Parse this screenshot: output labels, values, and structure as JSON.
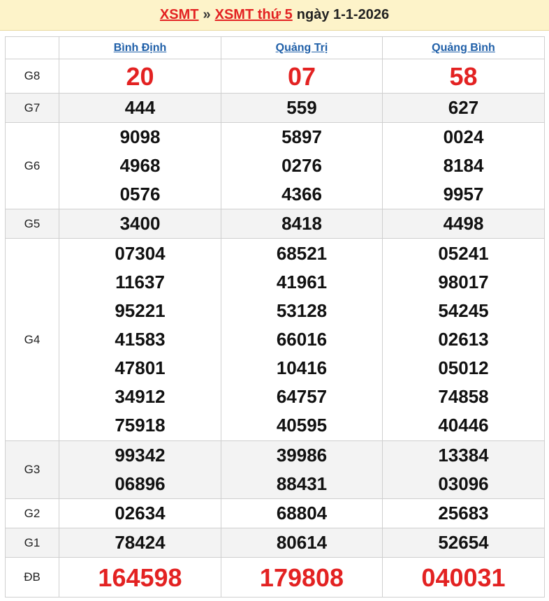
{
  "header": {
    "link1": "XSMT",
    "separator": "»",
    "link2": "XSMT thứ 5",
    "date_text": "ngày 1-1-2026"
  },
  "provinces": [
    "Bình Định",
    "Quảng Trị",
    "Quảng Bình"
  ],
  "prizes": [
    {
      "label": "G8",
      "values": [
        [
          "20"
        ],
        [
          "07"
        ],
        [
          "58"
        ]
      ]
    },
    {
      "label": "G7",
      "values": [
        [
          "444"
        ],
        [
          "559"
        ],
        [
          "627"
        ]
      ]
    },
    {
      "label": "G6",
      "values": [
        [
          "9098",
          "4968",
          "0576"
        ],
        [
          "5897",
          "0276",
          "4366"
        ],
        [
          "0024",
          "8184",
          "9957"
        ]
      ]
    },
    {
      "label": "G5",
      "values": [
        [
          "3400"
        ],
        [
          "8418"
        ],
        [
          "4498"
        ]
      ]
    },
    {
      "label": "G4",
      "values": [
        [
          "07304",
          "11637",
          "95221",
          "41583",
          "47801",
          "34912",
          "75918"
        ],
        [
          "68521",
          "41961",
          "53128",
          "66016",
          "10416",
          "64757",
          "40595"
        ],
        [
          "05241",
          "98017",
          "54245",
          "02613",
          "05012",
          "74858",
          "40446"
        ]
      ]
    },
    {
      "label": "G3",
      "values": [
        [
          "99342",
          "06896"
        ],
        [
          "39986",
          "88431"
        ],
        [
          "13384",
          "03096"
        ]
      ]
    },
    {
      "label": "G2",
      "values": [
        [
          "02634"
        ],
        [
          "68804"
        ],
        [
          "25683"
        ]
      ]
    },
    {
      "label": "G1",
      "values": [
        [
          "78424"
        ],
        [
          "80614"
        ],
        [
          "52654"
        ]
      ]
    },
    {
      "label": "ĐB",
      "values": [
        [
          "164598"
        ],
        [
          "179808"
        ],
        [
          "040031"
        ]
      ]
    }
  ],
  "colors": {
    "header_bg": "#fdf3c9",
    "accent_red": "#e32222",
    "link_blue": "#1f5fa8",
    "row_shade": "#f3f3f3"
  }
}
